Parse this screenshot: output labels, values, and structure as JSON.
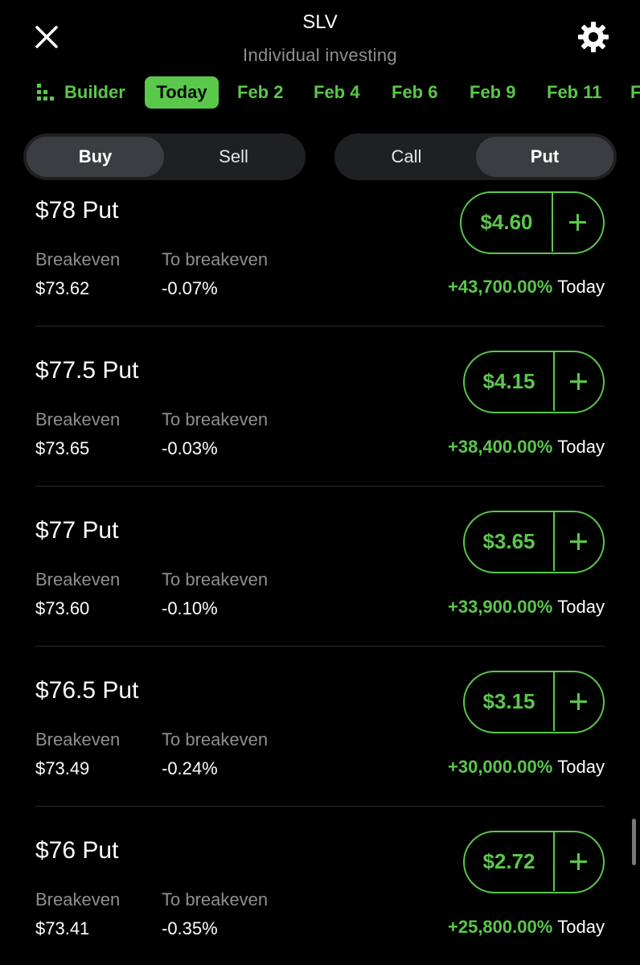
{
  "header": {
    "title": "SLV",
    "subtitle": "Individual investing",
    "close_icon": "close-icon",
    "settings_icon": "gear-icon"
  },
  "tabs": {
    "builder_label": "Builder",
    "items": [
      "Today",
      "Feb 2",
      "Feb 4",
      "Feb 6",
      "Feb 9",
      "Feb 11",
      "F"
    ],
    "active": "Today"
  },
  "side_toggle": {
    "buy": "Buy",
    "sell": "Sell",
    "selected": "Buy"
  },
  "type_toggle": {
    "call": "Call",
    "put": "Put",
    "selected": "Put"
  },
  "labels": {
    "breakeven": "Breakeven",
    "to_breakeven": "To breakeven",
    "period": "Today"
  },
  "options": [
    {
      "strike": "$78 Put",
      "breakeven": "$73.62",
      "to_breakeven": "-0.07%",
      "price": "$4.60",
      "change": "+43,700.00%"
    },
    {
      "strike": "$77.5 Put",
      "breakeven": "$73.65",
      "to_breakeven": "-0.03%",
      "price": "$4.15",
      "change": "+38,400.00%"
    },
    {
      "strike": "$77 Put",
      "breakeven": "$73.60",
      "to_breakeven": "-0.10%",
      "price": "$3.65",
      "change": "+33,900.00%"
    },
    {
      "strike": "$76.5 Put",
      "breakeven": "$73.49",
      "to_breakeven": "-0.24%",
      "price": "$3.15",
      "change": "+30,000.00%"
    },
    {
      "strike": "$76 Put",
      "breakeven": "$73.41",
      "to_breakeven": "-0.35%",
      "price": "$2.72",
      "change": "+25,800.00%"
    }
  ],
  "colors": {
    "accent": "#5ac84a",
    "muted": "#8f8f8f",
    "background": "#000000"
  }
}
